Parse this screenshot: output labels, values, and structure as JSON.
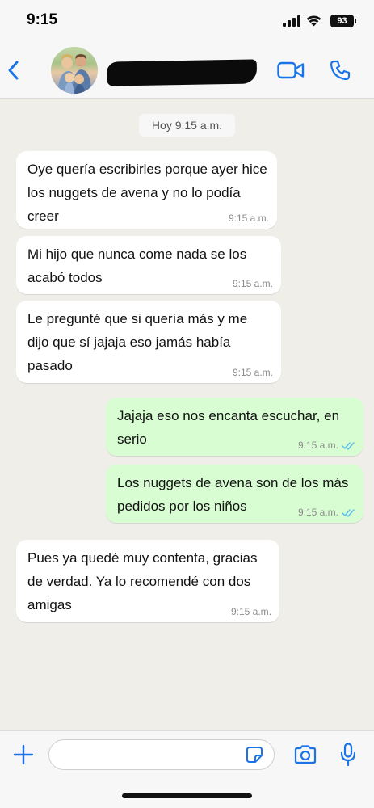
{
  "status_bar": {
    "time": "9:15",
    "battery": "93"
  },
  "header": {
    "contact_name_redacted": true
  },
  "conversation": {
    "date_chip": "Hoy 9:15 a.m.",
    "messages": [
      {
        "direction": "in",
        "text": "Oye quería escribirles porque ayer hice los nuggets de avena y no lo podía creer",
        "time": "9:15 a.m."
      },
      {
        "direction": "in",
        "text": "Mi hijo que nunca come nada se los acabó todos",
        "time": "9:15 a.m."
      },
      {
        "direction": "in",
        "text": "Le pregunté que si quería más y me dijo que sí jajaja eso jamás había pasado",
        "time": "9:15 a.m."
      },
      {
        "direction": "out",
        "text": "Jajaja eso nos encanta escuchar, en serio",
        "time": "9:15 a.m.",
        "status": "read"
      },
      {
        "direction": "out",
        "text": "Los nuggets de avena son de los más pedidos por los niños",
        "time": "9:15 a.m.",
        "status": "read"
      },
      {
        "direction": "in",
        "text": "Pues ya quedé muy contenta, gracias de verdad. Ya lo recomendé con dos amigas",
        "time": "9:15 a.m."
      }
    ]
  },
  "input_bar": {
    "value": "",
    "placeholder": ""
  },
  "icons": {
    "back": "chevron-left-icon",
    "video": "video-camera-icon",
    "phone": "phone-icon",
    "plus": "plus-icon",
    "sticker": "sticker-icon",
    "camera": "camera-icon",
    "mic": "microphone-icon",
    "read": "double-check-icon"
  },
  "colors": {
    "accent": "#1a73e8",
    "incoming_bubble": "#ffffff",
    "outgoing_bubble": "#d9fdd3",
    "chat_background": "#f0eee9",
    "read_ticks": "#53bdeb"
  }
}
